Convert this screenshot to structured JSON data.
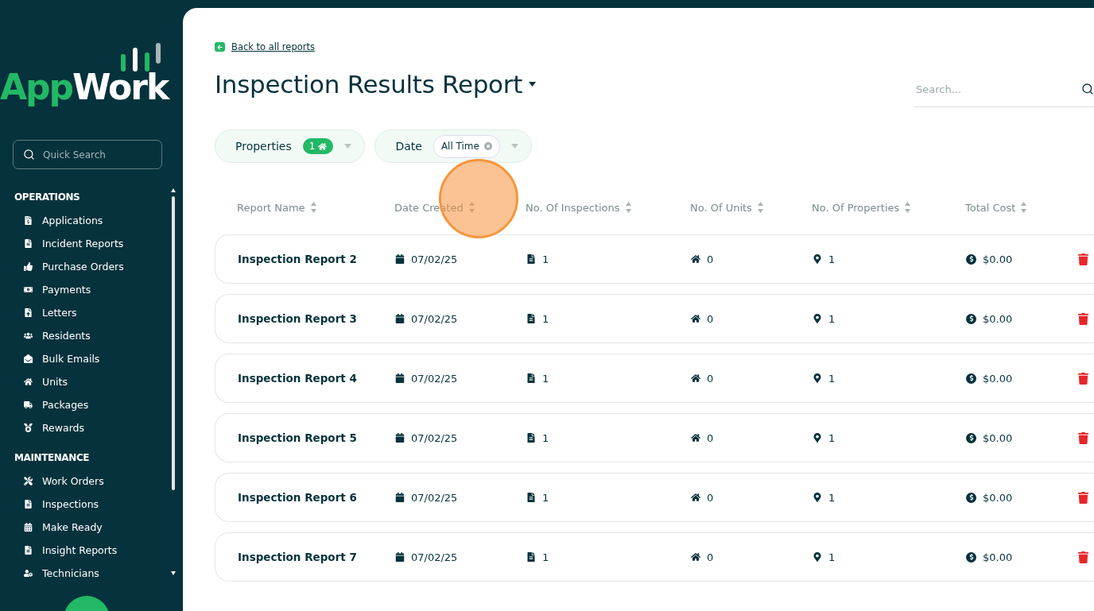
{
  "sidebar": {
    "logo": {
      "part_1": "App",
      "part_2": "Work"
    },
    "quick_search": {
      "placeholder": "Quick Search"
    },
    "sections": [
      {
        "title": "OPERATIONS",
        "items": [
          {
            "label": "Applications"
          },
          {
            "label": "Incident Reports"
          },
          {
            "label": "Purchase Orders"
          },
          {
            "label": "Payments"
          },
          {
            "label": "Letters"
          },
          {
            "label": "Residents"
          },
          {
            "label": "Bulk Emails"
          },
          {
            "label": "Units"
          },
          {
            "label": "Packages"
          },
          {
            "label": "Rewards"
          }
        ]
      },
      {
        "title": "MAINTENANCE",
        "items": [
          {
            "label": "Work Orders"
          },
          {
            "label": "Inspections"
          },
          {
            "label": "Make Ready"
          },
          {
            "label": "Insight Reports"
          },
          {
            "label": "Technicians"
          }
        ]
      }
    ]
  },
  "back_link": "Back to all reports",
  "title": "Inspection Results Report",
  "search": {
    "placeholder": "Search..."
  },
  "filters": [
    {
      "label": "Properties",
      "kind": "count",
      "value": "1"
    },
    {
      "label": "Date",
      "kind": "chip",
      "value": "All Time"
    }
  ],
  "table": {
    "columns": [
      "Report Name",
      "Date Created",
      "No. Of Inspections",
      "No. Of Units",
      "No. Of Properties",
      "Total Cost"
    ],
    "rows": [
      {
        "name": "Inspection Report 2",
        "date": "07/02/25",
        "inspections": "1",
        "units": "0",
        "properties": "1",
        "cost": "$0.00"
      },
      {
        "name": "Inspection Report 3",
        "date": "07/02/25",
        "inspections": "1",
        "units": "0",
        "properties": "1",
        "cost": "$0.00"
      },
      {
        "name": "Inspection Report 4",
        "date": "07/02/25",
        "inspections": "1",
        "units": "0",
        "properties": "1",
        "cost": "$0.00"
      },
      {
        "name": "Inspection Report 5",
        "date": "07/02/25",
        "inspections": "1",
        "units": "0",
        "properties": "1",
        "cost": "$0.00"
      },
      {
        "name": "Inspection Report 6",
        "date": "07/02/25",
        "inspections": "1",
        "units": "0",
        "properties": "1",
        "cost": "$0.00"
      },
      {
        "name": "Inspection Report 7",
        "date": "07/02/25",
        "inspections": "1",
        "units": "0",
        "properties": "1",
        "cost": "$0.00"
      }
    ]
  }
}
